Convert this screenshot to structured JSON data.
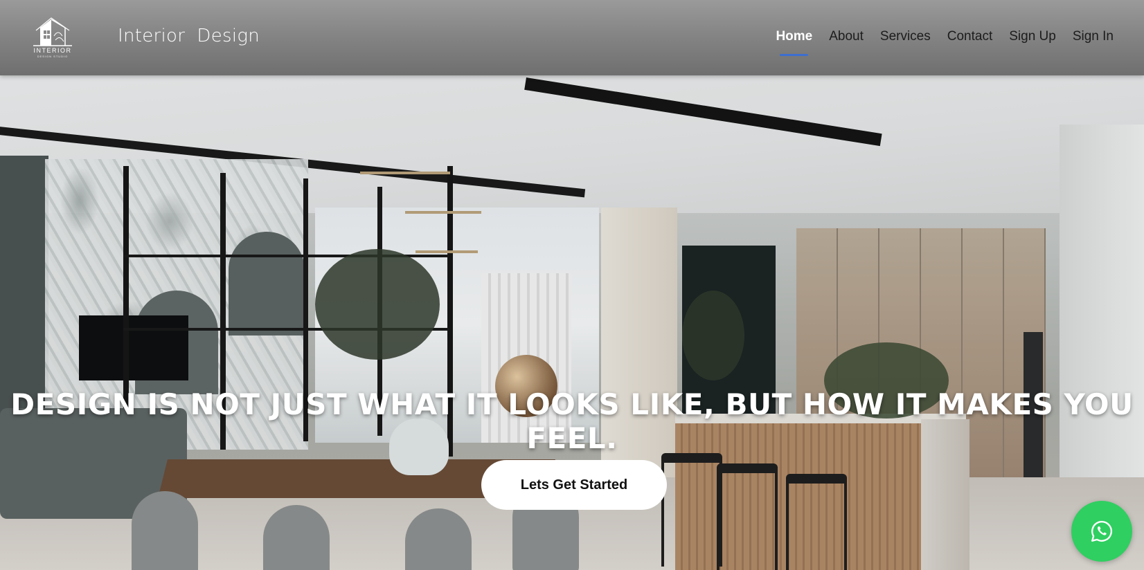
{
  "brand": {
    "logo_word": "INTERIOR",
    "logo_sub": "DESIGN STUDIO",
    "name": "Interior  Design",
    "icon": "house-logo-icon"
  },
  "nav": {
    "items": [
      {
        "label": "Home",
        "active": true
      },
      {
        "label": "About",
        "active": false
      },
      {
        "label": "Services",
        "active": false
      },
      {
        "label": "Contact",
        "active": false
      },
      {
        "label": "Sign Up",
        "active": false
      },
      {
        "label": "Sign In",
        "active": false
      }
    ],
    "active_underline_color": "#3d6fd1"
  },
  "hero": {
    "headline": "DESIGN IS NOT JUST WHAT IT LOOKS LIKE, BUT HOW IT MAKES YOU FEEL.",
    "cta_label": "Lets Get Started"
  },
  "floating": {
    "whatsapp_icon": "whatsapp-icon",
    "whatsapp_color": "#2fcf61"
  }
}
